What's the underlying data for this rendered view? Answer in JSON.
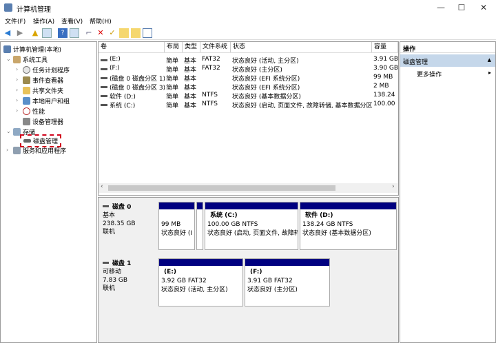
{
  "window": {
    "title": "计算机管理",
    "controls": [
      "—",
      "☐",
      "✕"
    ]
  },
  "menu": [
    "文件(F)",
    "操作(A)",
    "查看(V)",
    "帮助(H)"
  ],
  "toolbar": [
    "back-icon",
    "forward-icon",
    "up-icon",
    "show-hide-tree-icon",
    "help-icon",
    "properties-icon",
    "connect-icon",
    "delete-icon",
    "check-icon",
    "export-icon",
    "open-icon",
    "view-icon"
  ],
  "tree": {
    "root": "计算机管理(本地)",
    "system_tools": "系统工具",
    "children": [
      "任务计划程序",
      "事件查看器",
      "共享文件夹",
      "本地用户和组",
      "性能",
      "设备管理器"
    ],
    "storage": "存储",
    "disk_management": "磁盘管理",
    "services": "服务和应用程序"
  },
  "volumes": {
    "columns": [
      "卷",
      "布局",
      "类型",
      "文件系统",
      "状态",
      "容量"
    ],
    "rows": [
      [
        "(E:)",
        "简单",
        "基本",
        "FAT32",
        "状态良好 (活动, 主分区)",
        "3.91 GB"
      ],
      [
        "(F:)",
        "简单",
        "基本",
        "FAT32",
        "状态良好 (主分区)",
        "3.90 GB"
      ],
      [
        "(磁盘 0 磁盘分区 1)",
        "简单",
        "基本",
        "",
        "状态良好 (EFI 系统分区)",
        "99 MB"
      ],
      [
        "(磁盘 0 磁盘分区 3)",
        "简单",
        "基本",
        "",
        "状态良好 (EFI 系统分区)",
        "2 MB"
      ],
      [
        "软件 (D:)",
        "简单",
        "基本",
        "NTFS",
        "状态良好 (基本数据分区)",
        "138.24"
      ],
      [
        "系统 (C:)",
        "简单",
        "基本",
        "NTFS",
        "状态良好 (启动, 页面文件, 故障转储, 基本数据分区)",
        "100.00"
      ]
    ]
  },
  "disks": [
    {
      "name": "磁盘 0",
      "type": "基本",
      "size": "238.35 GB",
      "status": "联机",
      "partitions": [
        {
          "name": "",
          "size": "99 MB",
          "status": "状态良好 (I"
        },
        {
          "name": "",
          "size": "",
          "status": ""
        },
        {
          "name": "系统  (C:)",
          "size": "100.00 GB NTFS",
          "status": "状态良好 (启动, 页面文件, 故障转储"
        },
        {
          "name": "软件  (D:)",
          "size": "138.24 GB NTFS",
          "status": "状态良好 (基本数据分区)"
        }
      ]
    },
    {
      "name": "磁盘 1",
      "type": "可移动",
      "size": "7.83 GB",
      "status": "联机",
      "partitions": [
        {
          "name": "(E:)",
          "size": "3.92 GB FAT32",
          "status": "状态良好 (活动, 主分区)"
        },
        {
          "name": "(F:)",
          "size": "3.91 GB FAT32",
          "status": "状态良好 (主分区)"
        }
      ]
    }
  ],
  "actions": {
    "header": "操作",
    "section": "磁盘管理",
    "more": "更多操作"
  },
  "colors": {
    "partition_bar": "#000080",
    "selected_header": "#c5d7ea",
    "highlight": "#d0021b"
  }
}
